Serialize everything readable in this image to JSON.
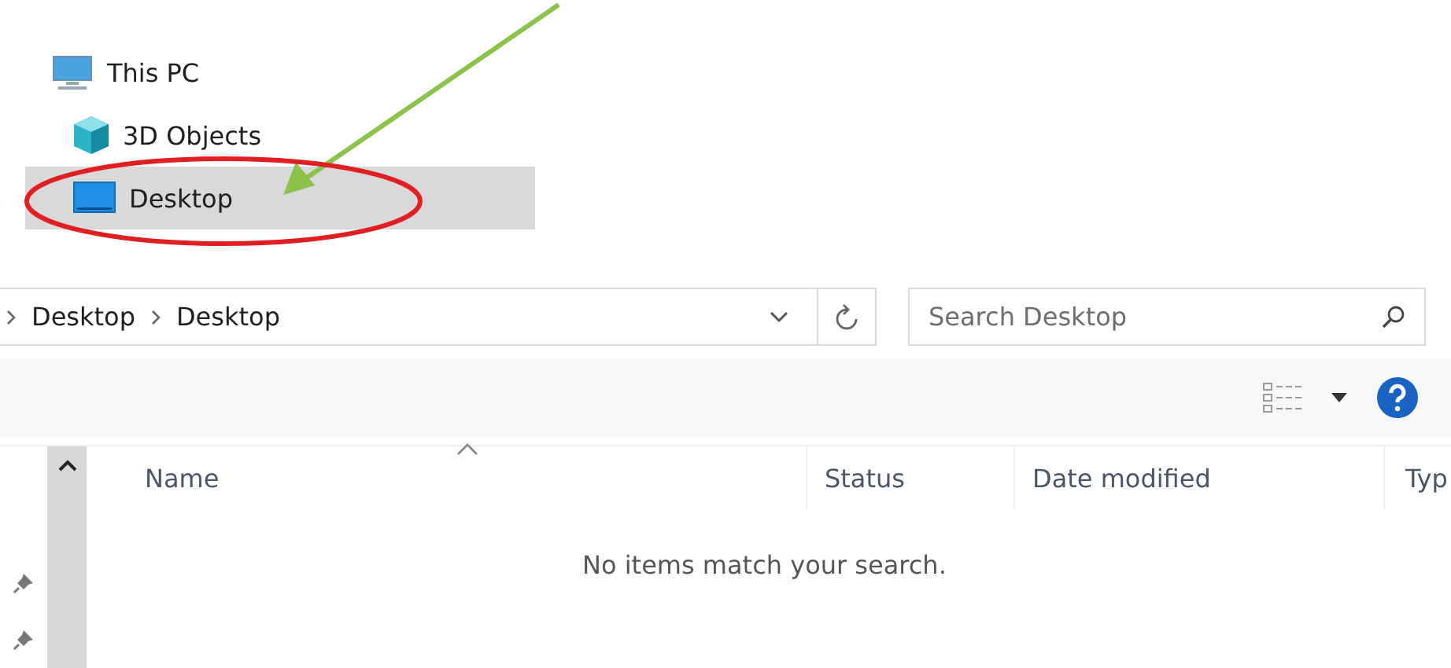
{
  "tree": [
    {
      "label": "This PC",
      "kind": "pc",
      "selected": false,
      "children": [
        {
          "label": "3D Objects",
          "kind": "cube",
          "selected": false
        },
        {
          "label": "Desktop",
          "kind": "desktop",
          "selected": true
        }
      ]
    }
  ],
  "address": {
    "crumbs": [
      "Desktop",
      "Desktop"
    ]
  },
  "search": {
    "placeholder": "Search Desktop"
  },
  "columns": [
    {
      "label": "Name",
      "sorted": true
    },
    {
      "label": "Status",
      "sorted": false
    },
    {
      "label": "Date modified",
      "sorted": false
    },
    {
      "label": "Typ",
      "sorted": false
    }
  ],
  "empty_message": "No items match your search.",
  "pins": [
    {
      "kind": "pin"
    },
    {
      "kind": "pin"
    }
  ],
  "annotations": [
    {
      "kind": "arrow",
      "color": "#8bc34a"
    },
    {
      "kind": "ellipse",
      "color": "#e02020"
    }
  ]
}
